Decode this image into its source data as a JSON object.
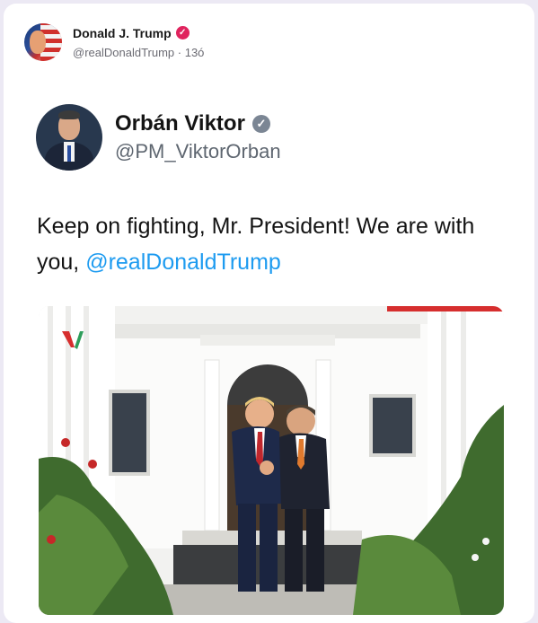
{
  "post": {
    "author_name": "Donald J. Trump",
    "author_handle": "@realDonaldTrump",
    "separator": " · ",
    "time": "13ó",
    "verified_icon": "verified-badge-icon"
  },
  "embed": {
    "name": "Orbán Viktor",
    "handle": "@PM_ViktorOrban",
    "verified_icon": "verified-badge-icon",
    "text_before": "Keep on fighting, Mr. President! We are with you, ",
    "mention": "@realDonaldTrump",
    "media": {
      "type": "photo",
      "icon": "brand-v-logo-icon",
      "colors": {
        "accent_red": "#d62e2e",
        "accent_green": "#2e9e5b",
        "mention": "#1d9bf0"
      }
    }
  }
}
